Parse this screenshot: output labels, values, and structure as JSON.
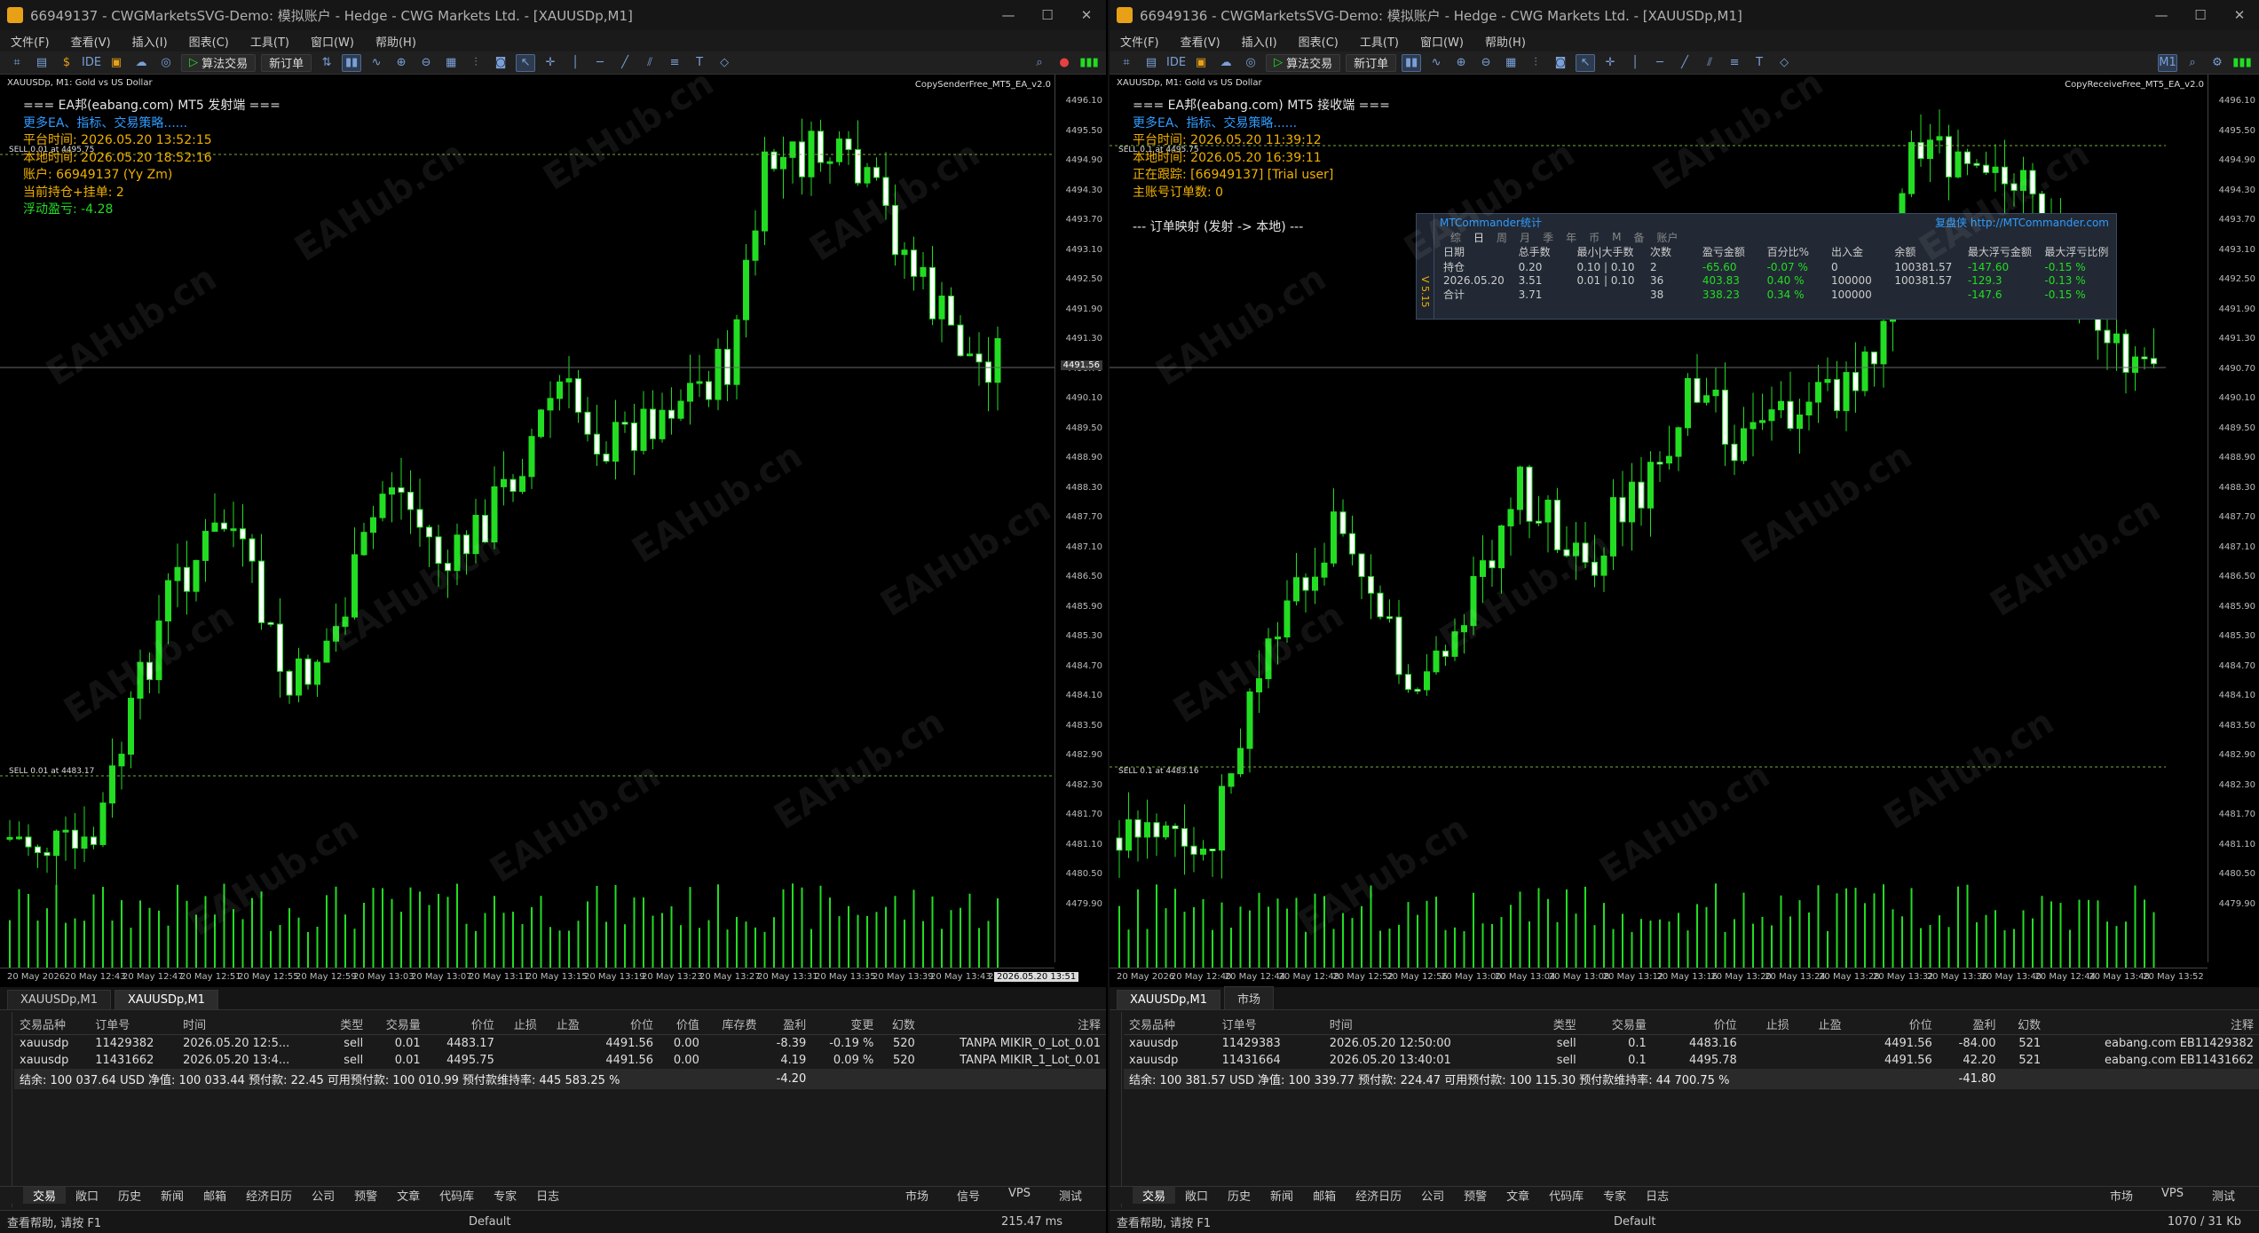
{
  "left": {
    "title": "66949137 - CWGMarketsSVG-Demo: 模拟账户 - Hedge - CWG Markets Ltd. - [XAUUSDp,M1]",
    "menu": [
      "文件(F)",
      "查看(V)",
      "插入(I)",
      "图表(C)",
      "工具(T)",
      "窗口(W)",
      "帮助(H)"
    ],
    "toolbar": {
      "algo": "算法交易",
      "neworder": "新订单",
      "ide": "IDE"
    },
    "symbol_label": "XAUUSDp, M1:  Gold vs US Dollar",
    "ea_label": "CopySenderFree_MT5_EA_v2.0",
    "info": [
      {
        "text": "=== EA邦(eabang.com) MT5 发射端 ===",
        "cls": "c-white"
      },
      {
        "text": "更多EA、指标、交易策略......",
        "cls": "c-blue"
      },
      {
        "text": "平台时间: 2026.05.20 13:52:15",
        "cls": "c-orange"
      },
      {
        "text": "本地时间: 2026.05.20 18:52:16",
        "cls": "c-orange"
      },
      {
        "text": "账户: 66949137 (Yy Zm)",
        "cls": "c-orange"
      },
      {
        "text": "当前持仓+挂单: 2",
        "cls": "c-orange"
      },
      {
        "text": "浮动盈亏: -4.28",
        "cls": "c-green"
      }
    ],
    "sell_label_top": "SELL 0.01 at 4495.75",
    "sell_label_bottom": "SELL 0.01 at 4483.17",
    "prices": [
      "4496.10",
      "4495.50",
      "4494.90",
      "4494.30",
      "4493.70",
      "4493.10",
      "4492.50",
      "4491.90",
      "4491.30",
      "4490.70",
      "4490.10",
      "4489.50",
      "4488.90",
      "4488.30",
      "4487.70",
      "4487.10",
      "4486.50",
      "4485.90",
      "4485.30",
      "4484.70",
      "4484.10",
      "4483.50",
      "4482.90",
      "4482.30",
      "4481.70",
      "4481.10",
      "4480.50",
      "4479.90"
    ],
    "current_price": "4491.56",
    "times": [
      "20 May 2026",
      "20 May 12:43",
      "20 May 12:47",
      "20 May 12:51",
      "20 May 12:55",
      "20 May 12:59",
      "20 May 13:03",
      "20 May 13:07",
      "20 May 13:11",
      "20 May 13:15",
      "20 May 13:19",
      "20 May 13:23",
      "20 May 13:27",
      "20 May 13:31",
      "20 May 13:35",
      "20 May 13:39",
      "20 May 13:43",
      "20 Ma"
    ],
    "time_cursor": "2026.05.20 13:51",
    "chart_tabs": [
      "XAUUSDp,M1",
      "XAUUSDp,M1"
    ],
    "table": {
      "headers": [
        "交易品种",
        "订单号",
        "时间",
        "类型",
        "交易量",
        "价位",
        "止损",
        "止盈",
        "价位",
        "价值",
        "库存费",
        "盈利",
        "变更",
        "幻数",
        "注释"
      ],
      "rows": [
        [
          "xauusdp",
          "11429382",
          "2026.05.20 12:5...",
          "sell",
          "0.01",
          "4483.17",
          "",
          "",
          "4491.56",
          "0.00",
          "",
          "-8.39",
          "-0.19 %",
          "520",
          "TANPA MIKIR_0_Lot_0.01"
        ],
        [
          "xauusdp",
          "11431662",
          "2026.05.20 13:4...",
          "sell",
          "0.01",
          "4495.75",
          "",
          "",
          "4491.56",
          "0.00",
          "",
          "4.19",
          "0.09 %",
          "520",
          "TANPA MIKIR_1_Lot_0.01"
        ]
      ],
      "balance": "结余: 100 037.64 USD  净值: 100 033.44  预付款: 22.45  可用预付款: 100 010.99  预付款维持率: 445 583.25 %",
      "balance_profit": "-4.20"
    },
    "bottom_tabs": [
      "交易",
      "敞口",
      "历史",
      "新闻",
      "邮箱",
      "经济日历",
      "公司",
      "预警",
      "文章",
      "代码库",
      "专家",
      "日志"
    ],
    "bottom_right": [
      "市场",
      "信号",
      "VPS",
      "测试"
    ],
    "status": {
      "help": "查看帮助, 请按 F1",
      "profile": "Default",
      "ping": "215.47 ms"
    }
  },
  "right": {
    "title": "66949136 - CWGMarketsSVG-Demo: 模拟账户 - Hedge - CWG Markets Ltd. - [XAUUSDp,M1]",
    "menu": [
      "文件(F)",
      "查看(V)",
      "插入(I)",
      "图表(C)",
      "工具(T)",
      "窗口(W)",
      "帮助(H)"
    ],
    "toolbar": {
      "algo": "算法交易",
      "neworder": "新订单",
      "ide": "IDE"
    },
    "symbol_label": "XAUUSDp, M1:  Gold vs US Dollar",
    "ea_label": "CopyReceiveFree_MT5_EA_v2.0",
    "info": [
      {
        "text": "=== EA邦(eabang.com) MT5 接收端 ===",
        "cls": "c-white"
      },
      {
        "text": "更多EA、指标、交易策略......",
        "cls": "c-blue"
      },
      {
        "text": "平台时间: 2026.05.20 11:39:12",
        "cls": "c-orange"
      },
      {
        "text": "本地时间: 2026.05.20 16:39:11",
        "cls": "c-orange"
      },
      {
        "text": "正在跟踪: [66949137] [Trial user]",
        "cls": "c-orange"
      },
      {
        "text": "主账号订单数: 0",
        "cls": "c-orange"
      },
      {
        "text": "",
        "cls": "c-white"
      },
      {
        "text": "--- 订单映射 (发射 -> 本地) ---",
        "cls": "c-white"
      }
    ],
    "sell_label_top": "SELL 0.1 at 4495.75",
    "sell_label_bottom": "SELL 0.1 at 4483.16",
    "mtc": {
      "title": "MTCommander统计",
      "link": "复盘侠 http://MTCommander.com",
      "tabs": [
        "综",
        "日",
        "周",
        "月",
        "季",
        "年",
        "币",
        "M",
        "备",
        "账户"
      ],
      "headers": [
        "日期",
        "总手数",
        "最小|大手数",
        "次数",
        "盈亏金额",
        "百分比%",
        "出入金",
        "余额",
        "最大浮亏金额",
        "最大浮亏比例"
      ],
      "rows": [
        [
          "持仓",
          "0.20",
          "0.10 | 0.10",
          "2",
          "-65.60",
          "-0.07 %",
          "0",
          "100381.57",
          "-147.60",
          "-0.15 %"
        ],
        [
          "2026.05.20",
          "3.51",
          "0.01 | 0.10",
          "36",
          "403.83",
          "0.40 %",
          "100000",
          "100381.57",
          "-129.3",
          "-0.13 %"
        ],
        [
          "合计",
          "3.71",
          "",
          "38",
          "338.23",
          "0.34 %",
          "100000",
          "",
          "-147.6",
          "-0.15 %"
        ]
      ],
      "side": "V 5.15"
    },
    "prices": [
      "4496.10",
      "4495.50",
      "4494.90",
      "4494.30",
      "4493.70",
      "4493.10",
      "4492.50",
      "4491.90",
      "4491.30",
      "4490.70",
      "4490.10",
      "4489.50",
      "4488.90",
      "4488.30",
      "4487.70",
      "4487.10",
      "4486.50",
      "4485.90",
      "4485.30",
      "4484.70",
      "4484.10",
      "4483.50",
      "4482.90",
      "4482.30",
      "4481.70",
      "4481.10",
      "4480.50",
      "4479.90"
    ],
    "times": [
      "20 May 2026",
      "20 May 12:40",
      "20 May 12:44",
      "20 May 12:48",
      "20 May 12:52",
      "20 May 12:56",
      "20 May 13:00",
      "20 May 13:04",
      "20 May 13:08",
      "20 May 13:12",
      "20 May 13:16",
      "20 May 13:20",
      "20 May 13:24",
      "20 May 13:28",
      "20 May 13:32",
      "20 May 13:36",
      "20 May 13:40",
      "20 May 12:44",
      "20 May 13:48",
      "20 May 13:52"
    ],
    "chart_tabs": [
      "XAUUSDp,M1",
      "市场"
    ],
    "table": {
      "headers": [
        "交易品种",
        "订单号",
        "时间",
        "类型",
        "交易量",
        "价位",
        "止损",
        "止盈",
        "价位",
        "盈利",
        "幻数",
        "注释"
      ],
      "rows": [
        [
          "xauusdp",
          "11429383",
          "2026.05.20 12:50:00",
          "sell",
          "0.1",
          "4483.16",
          "",
          "",
          "4491.56",
          "-84.00",
          "521",
          "eabang.com EB11429382"
        ],
        [
          "xauusdp",
          "11431664",
          "2026.05.20 13:40:01",
          "sell",
          "0.1",
          "4495.78",
          "",
          "",
          "4491.56",
          "42.20",
          "521",
          "eabang.com EB11431662"
        ]
      ],
      "balance": "结余: 100 381.57 USD  净值: 100 339.77  预付款: 224.47  可用预付款: 100 115.30  预付款维持率: 44 700.75 %",
      "balance_profit": "-41.80"
    },
    "bottom_tabs": [
      "交易",
      "敞口",
      "历史",
      "新闻",
      "邮箱",
      "经济日历",
      "公司",
      "预警",
      "文章",
      "代码库",
      "专家",
      "日志"
    ],
    "bottom_right": [
      "市场",
      "VPS",
      "测试"
    ],
    "status": {
      "help": "查看帮助, 请按 F1",
      "profile": "Default",
      "traffic": "1070 / 31 Kb"
    }
  },
  "watermark": "EAHub.cn",
  "colors": {
    "bull": "#22dd22",
    "bear": "#ffffff",
    "info_orange": "#f0b000",
    "info_blue": "#2f9cff",
    "loss": "#ff4a4a",
    "profit": "#3aa3ff"
  }
}
